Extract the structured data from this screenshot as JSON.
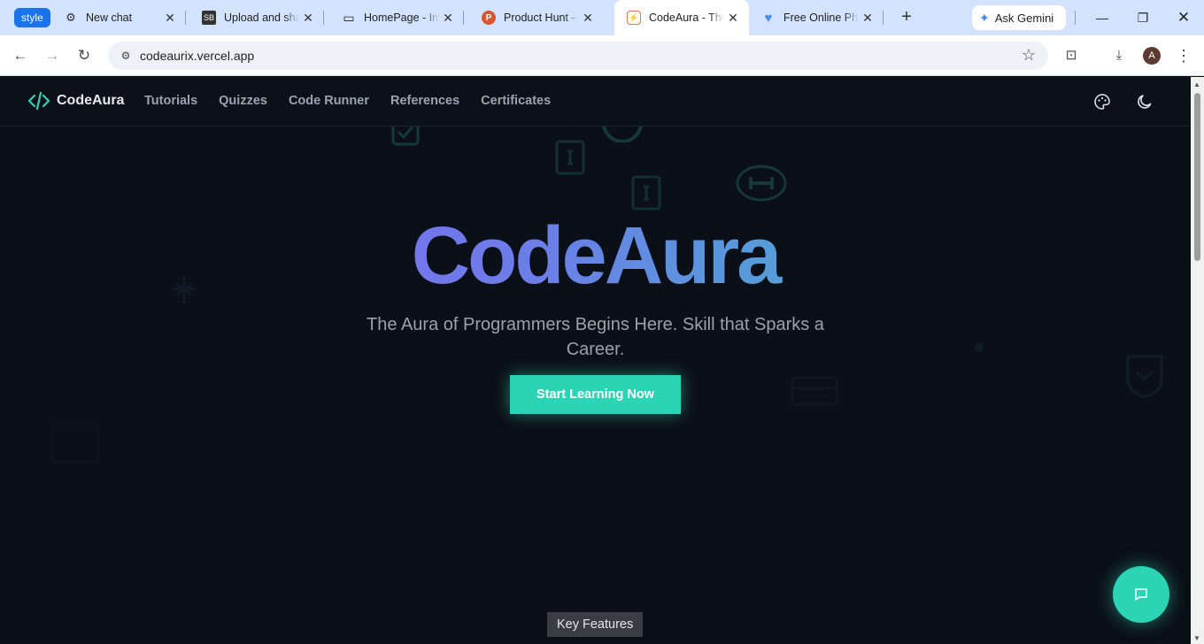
{
  "browser": {
    "tab_group_label": "style",
    "tabs": [
      {
        "title": "New chat",
        "favicon": "openai-icon"
      },
      {
        "title": "Upload and share",
        "favicon": "sb-icon"
      },
      {
        "title": "HomePage - Ima",
        "favicon": "monitor-icon"
      },
      {
        "title": "Product Hunt – ",
        "favicon": "producthunt-icon"
      },
      {
        "title": "CodeAura - The",
        "favicon": "codeaura-icon",
        "active": true
      },
      {
        "title": "Free Online Pho",
        "favicon": "heart-icon"
      }
    ],
    "gemini_label": "Ask Gemini",
    "url": "codeaurix.vercel.app",
    "avatar_letter": "A"
  },
  "site": {
    "brand": "CodeAura",
    "nav": [
      "Tutorials",
      "Quizzes",
      "Code Runner",
      "References",
      "Certificates"
    ],
    "hero_title": "CodeAura",
    "hero_subtitle": "The Aura of Programmers Begins Here. Skill that Sparks a Career.",
    "cta_label": "Start Learning Now",
    "key_features_label": "Key Features"
  },
  "colors": {
    "accent": "#2bd4b4",
    "gradient_start": "#8b5cf6",
    "gradient_end": "#2dd4bf",
    "page_bg": "#0b0f17"
  }
}
